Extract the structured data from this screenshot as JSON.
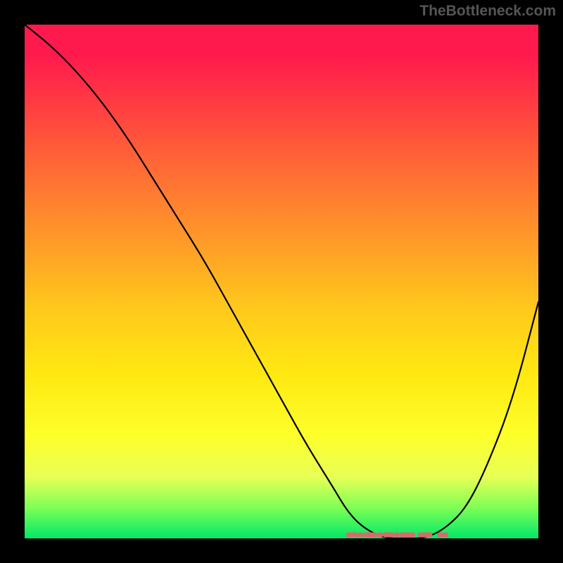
{
  "watermark": "TheBottleneck.com",
  "chart_data": {
    "type": "line",
    "title": "",
    "xlabel": "",
    "ylabel": "",
    "xlim": [
      0,
      100
    ],
    "ylim": [
      0,
      100
    ],
    "grid": false,
    "background": "gradient-heatmap",
    "gradient_stops": [
      {
        "pos": 0.0,
        "color": "#ff1a4e"
      },
      {
        "pos": 0.06,
        "color": "#ff1a4e"
      },
      {
        "pos": 0.15,
        "color": "#ff3a42"
      },
      {
        "pos": 0.28,
        "color": "#ff6a35"
      },
      {
        "pos": 0.42,
        "color": "#ff9a28"
      },
      {
        "pos": 0.55,
        "color": "#ffc81c"
      },
      {
        "pos": 0.68,
        "color": "#ffe812"
      },
      {
        "pos": 0.8,
        "color": "#feff2a"
      },
      {
        "pos": 0.88,
        "color": "#e8ff55"
      },
      {
        "pos": 0.94,
        "color": "#7fff55"
      },
      {
        "pos": 1.0,
        "color": "#00e868"
      }
    ],
    "series": [
      {
        "name": "bottleneck-curve",
        "color": "#000000",
        "x": [
          0,
          5,
          10,
          15,
          20,
          25,
          30,
          35,
          40,
          45,
          50,
          55,
          60,
          63,
          66,
          70,
          74,
          78,
          82,
          86,
          90,
          95,
          100
        ],
        "y": [
          100,
          96,
          91,
          85,
          78,
          70,
          62,
          54,
          45,
          36,
          27,
          18,
          10,
          5,
          2,
          0,
          0,
          0,
          2,
          6,
          14,
          27,
          46
        ]
      }
    ],
    "annotations": [
      {
        "name": "optimal-flat-region",
        "style": "dashed-pink",
        "color": "#d96a6a",
        "x_start": 63,
        "x_end": 82,
        "y": 0
      }
    ]
  }
}
